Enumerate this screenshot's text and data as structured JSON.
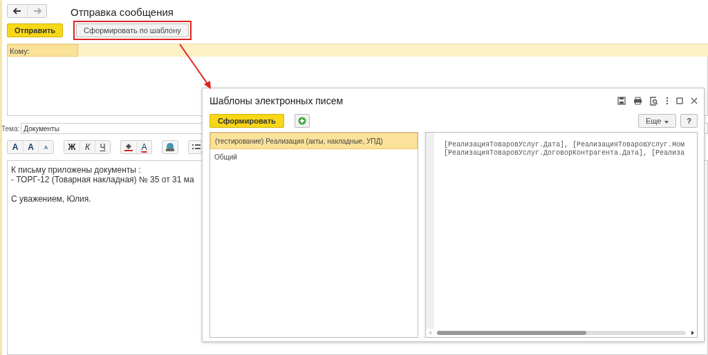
{
  "window": {
    "title": "Отправка сообщения"
  },
  "toolbar": {
    "send_button": "Отправить",
    "template_button": {
      "label": "Сформировать по шаблону",
      "highlighted": true
    }
  },
  "recipients": {
    "label": "Кому:"
  },
  "subject": {
    "label": "Тема:",
    "value": "Документы"
  },
  "format_toolbar": [
    {
      "group": [
        {
          "kind": "bold",
          "text": "А"
        },
        {
          "kind": "grow",
          "text": "А"
        },
        {
          "kind": "shrink",
          "text": "А"
        }
      ]
    },
    {
      "group": [
        {
          "kind": "bold",
          "text": "Ж"
        },
        {
          "kind": "italic",
          "text": "К"
        },
        {
          "kind": "underline",
          "text": "Ч"
        }
      ]
    },
    {
      "group": [
        {
          "kind": "fill"
        },
        {
          "kind": "fontcolor",
          "text": "А"
        }
      ]
    },
    {
      "group": [
        {
          "kind": "image"
        }
      ]
    },
    {
      "group": [
        {
          "kind": "list"
        }
      ]
    }
  ],
  "body": [
    [
      "К письму приложены документы :",
      "- ТОРГ-12 (Товарная накладная) № 35 от 31 ма"
    ],
    [
      "С уважением, Юлия."
    ]
  ],
  "dialog": {
    "title": "Шаблоны электронных писем",
    "generate_button": "Сформировать",
    "more_button": "Еще",
    "help_button": "?",
    "templates": [
      {
        "label": "(тестирование) Реализация (акты, накладные, УПД)",
        "selected": true
      },
      {
        "label": "Общий",
        "selected": false
      }
    ],
    "code_lines": [
      "[РеализацияТоваровУслуг.Дата], [РеализацияТоваровУслуг.Ном",
      "[РеализацияТоваровУслуг.ДоговорКонтрагента.Дата], [Реализа"
    ],
    "scroll": {
      "level": 0.6
    }
  }
}
